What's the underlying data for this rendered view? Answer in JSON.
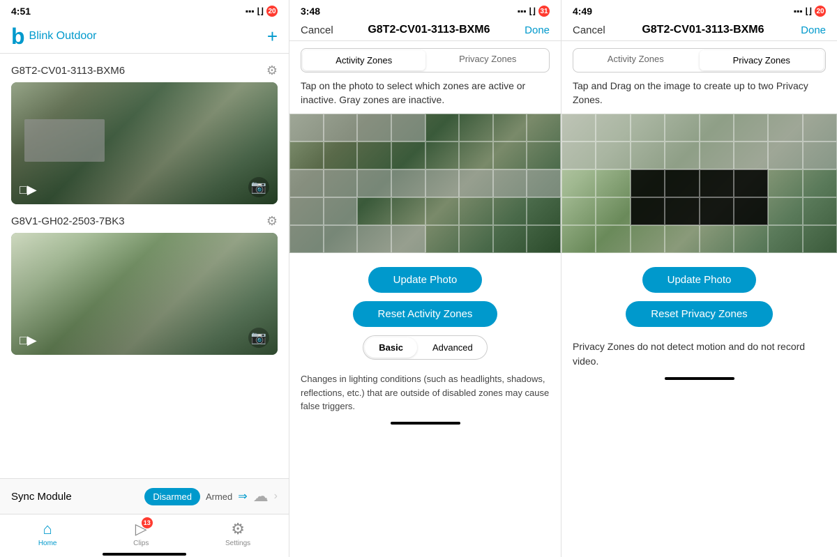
{
  "panel1": {
    "status_time": "4:51",
    "app_name": "Blink Outdoor",
    "camera1": {
      "name": "G8T2-CV01-3113-BXM6",
      "has_privacy_overlay": true
    },
    "camera2": {
      "name": "G8V1-GH02-2503-7BK3",
      "has_privacy_overlay": false
    },
    "sync_module": {
      "label": "Sync Module",
      "disarmed": "Disarmed",
      "armed": "Armed"
    },
    "tabs": {
      "home": "Home",
      "clips": "Clips",
      "settings": "Settings",
      "clips_badge": "13"
    }
  },
  "panel2": {
    "status_time": "3:48",
    "nav_cancel": "Cancel",
    "nav_title": "G8T2-CV01-3113-BXM6",
    "nav_done": "Done",
    "tabs": {
      "activity": "Activity Zones",
      "privacy": "Privacy Zones"
    },
    "active_tab": "Activity Zones",
    "description": "Tap on the photo to select which zones are active or inactive. Gray zones are inactive.",
    "btn_update": "Update Photo",
    "btn_reset": "Reset Activity Zones",
    "detection_basic": "Basic",
    "detection_advanced": "Advanced",
    "note": "Changes in lighting conditions (such as headlights, shadows, reflections, etc.) that are outside of disabled zones may cause false triggers."
  },
  "panel3": {
    "status_time": "4:49",
    "nav_cancel": "Cancel",
    "nav_title": "G8T2-CV01-3113-BXM6",
    "nav_done": "Done",
    "tabs": {
      "activity": "Activity Zones",
      "privacy": "Privacy Zones"
    },
    "active_tab": "Privacy Zones",
    "description": "Tap and Drag on the image to create up to two Privacy Zones.",
    "btn_update": "Update Photo",
    "btn_reset": "Reset Privacy Zones",
    "privacy_note": "Privacy Zones do not detect motion and do not record video."
  }
}
